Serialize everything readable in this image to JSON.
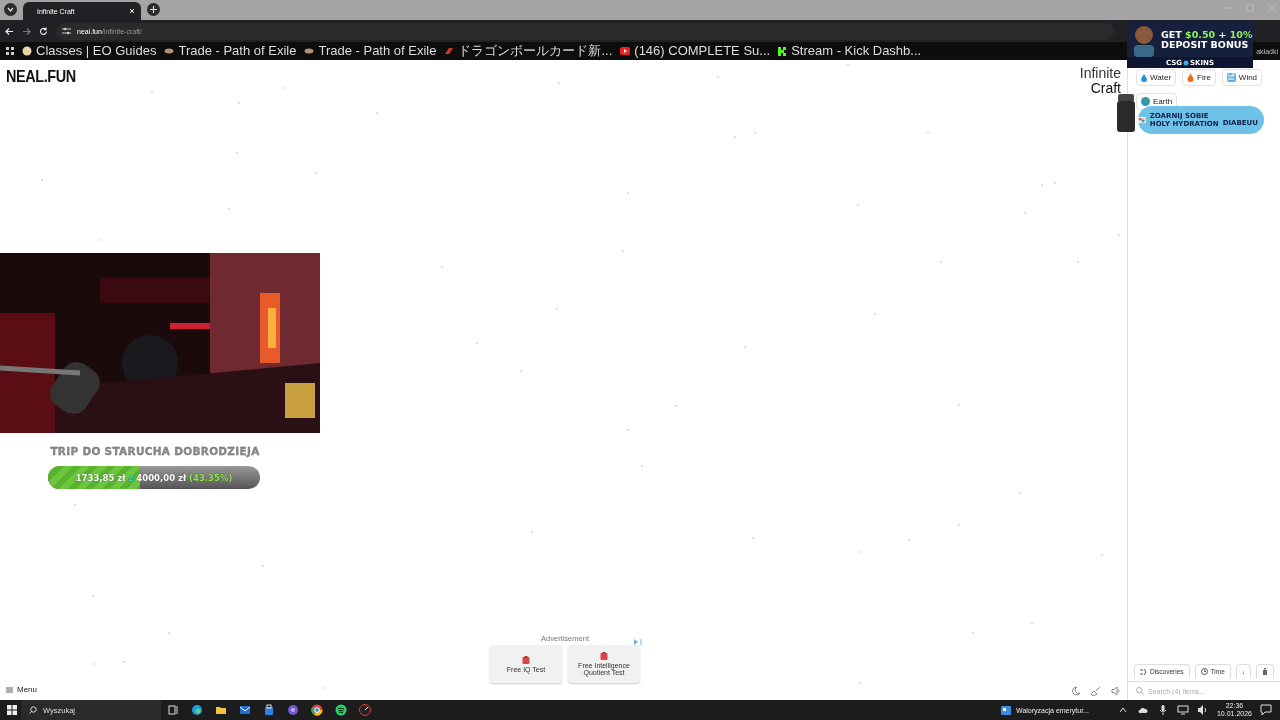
{
  "browser": {
    "tabs": [
      {
        "title": "Infinite Craft",
        "selected": true
      }
    ],
    "address": {
      "host": "neal.fun",
      "path": "/infinite-craft/"
    },
    "bookmarks": [
      {
        "label": "Classes | EO Guides",
        "kind": "guide"
      },
      {
        "label": "Trade - Path of Exile",
        "kind": "trade"
      },
      {
        "label": "Trade - Path of Exile",
        "kind": "trade"
      },
      {
        "label": "ドラゴンボールカード新...",
        "kind": "card"
      },
      {
        "label": "(146) COMPLETE Su...",
        "kind": "video"
      },
      {
        "label": "Stream - Kick Dashb...",
        "kind": "kick"
      }
    ],
    "bookmarks_overflow": "akładki"
  },
  "page": {
    "logo": "NEAL.FUN",
    "title": [
      "Infinite",
      "Craft"
    ],
    "elements": [
      {
        "label": "Water",
        "kind": "water"
      },
      {
        "label": "Fire",
        "kind": "fire"
      },
      {
        "label": "Wind",
        "kind": "wind"
      },
      {
        "label": "Earth",
        "kind": "earth"
      }
    ],
    "sort_buttons": [
      {
        "label": "Discoveries",
        "kind": "discoveries"
      },
      {
        "label": "Time",
        "kind": "time"
      },
      {
        "label": "↓",
        "kind": "arrow"
      },
      {
        "kind": "trash"
      }
    ],
    "search": {
      "placeholder": "Search (4) items..."
    },
    "menu": "Menu",
    "ad": {
      "label": "Advertisement",
      "items": [
        "Free IQ Test",
        "Free Intelligence Quotient Test"
      ]
    }
  },
  "overlays": {
    "top_ad": {
      "headline_parts": [
        {
          "text": "GET ",
          "color": "#ffffff"
        },
        {
          "text": "$0.50",
          "color": "#8ff05a"
        },
        {
          "text": " + ",
          "color": "#ffffff"
        },
        {
          "text": "10%",
          "color": "#8ff05a"
        }
      ],
      "line2": "DEPOSIT BONUS",
      "brand": [
        "CSG",
        "SKINS"
      ]
    },
    "side_ad": {
      "lines": [
        "ZOARNIJ SOBIE",
        "HOLY HYDRATION"
      ],
      "brand": "DIABEUU"
    },
    "goal": {
      "title": "TRIP DO STARUCHA DOBRODZIEJA",
      "parts": [
        {
          "text": "1733,85 zł ",
          "color": "#ffffff"
        },
        {
          "text": "z ",
          "color": "#3ad0c0"
        },
        {
          "text": "4000,00 zł ",
          "color": "#ffffff"
        },
        {
          "text": "(43.35%)",
          "color": "#8fe84a"
        }
      ],
      "level": 0.4335
    }
  },
  "taskbar": {
    "search": {
      "placeholder": "Wyszukaj"
    },
    "news": "Waloryzacja emerytur...",
    "time": "22:36",
    "date": "10.01.2026"
  }
}
